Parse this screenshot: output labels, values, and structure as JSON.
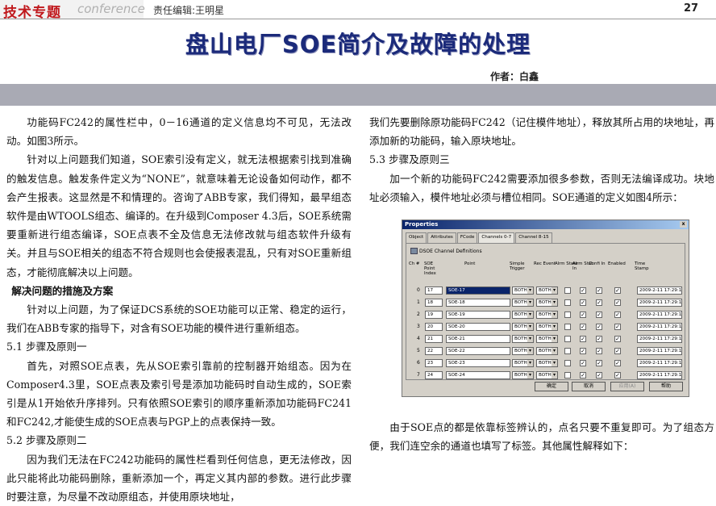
{
  "header": {
    "section_zh": "技术专题",
    "section_en": "conference",
    "editor": "责任编辑:王明星",
    "page_number": "27"
  },
  "article": {
    "title": "盘山电厂SOE简介及故障的处理",
    "author": "作者：白鑫"
  },
  "left_column": [
    {
      "type": "para",
      "text": "功能码FC242的属性栏中，0－16通道的定义信息均不可见，无法改动。如图3所示。"
    },
    {
      "type": "para",
      "text": "针对以上问题我们知道，SOE索引没有定义，就无法根据索引找到准确的触发信息。触发条件定义为“NONE”，就意味着无论设备如何动作，都不会产生报表。这显然是不和情理的。咨询了ABB专家，我们得知，最早组态软件是由WTOOLS组态、编译的。在升级到Composer 4.3后，SOE系统需要重新进行组态编译，SOE点表不全及信息无法修改就与组态软件升级有关。并且与SOE相关的组态不符合规则也会使报表混乱，只有对SOE重新组态，才能彻底解决以上问题。"
    },
    {
      "type": "heading",
      "text": "解决问题的措施及方案"
    },
    {
      "type": "para",
      "text": "针对以上问题，为了保证DCS系统的SOE功能可以正常、稳定的运行，我们在ABB专家的指导下，对含有SOE功能的模件进行重新组态。"
    },
    {
      "type": "sub",
      "text": "5.1 步骤及原则一"
    },
    {
      "type": "para",
      "text": "首先，对照SOE点表，先从SOE索引靠前的控制器开始组态。因为在Composer4.3里，SOE点表及索引号是添加功能码时自动生成的，SOE索引是从1开始依升序排列。只有依照SOE索引的顺序重新添加功能码FC241和FC242,才能使生成的SOE点表与PGP上的点表保持一致。"
    },
    {
      "type": "sub",
      "text": "5.2 步骤及原则二"
    },
    {
      "type": "para",
      "text": "因为我们无法在FC242功能码的属性栏看到任何信息，更无法修改，因此只能将此功能码删除，重新添加一个，再定义其内部的参数。进行此步骤时要注意，为尽量不改动原组态，并使用原块地址，"
    }
  ],
  "right_column_top": [
    {
      "type": "cont",
      "text": "我们先要删除原功能码FC242（记住模件地址），释放其所占用的块地址，再添加新的功能码，输入原块地址。"
    },
    {
      "type": "sub",
      "text": "5.3 步骤及原则三"
    },
    {
      "type": "para",
      "text": "加一个新的功能码FC242需要添加很多参数，否则无法编译成功。块地址必须输入，模件地址必须与槽位相同。SOE通道的定义如图4所示："
    }
  ],
  "right_column_bottom": [
    {
      "type": "para",
      "text": "由于SOE点的都是依靠标签辨认的，点名只要不重复即可。为了组态方便，我们连空余的通道也填写了标签。其他属性解释如下："
    }
  ],
  "dialog": {
    "title": "Properties",
    "close": "x",
    "tabs": [
      "Object",
      "Attributes",
      "FCode",
      "Channels 0-7",
      "Channel 8-15"
    ],
    "active_tab": "Channels 0-7",
    "group_title": "DSOE Channel Definitions",
    "columns": [
      "Ch #",
      "SOE Point Index",
      "Point",
      "Simple Trigger",
      "Rec Event",
      "Alrm State",
      "Alrm Stat In",
      "Confi In",
      "Enabled",
      "Time Stamp"
    ],
    "rows": [
      {
        "ch": "0",
        "index": "17",
        "point": "SOE-17",
        "trigger": "BOTH",
        "event": "BOTH",
        "alrm": false,
        "alrm_stat": true,
        "confi": true,
        "enabled": true,
        "ts": "2009-2-11 17:29:14",
        "selected": true
      },
      {
        "ch": "1",
        "index": "18",
        "point": "SOE-18",
        "trigger": "BOTH",
        "event": "BOTH",
        "alrm": false,
        "alrm_stat": true,
        "confi": true,
        "enabled": true,
        "ts": "2009-2-11 17:29:14",
        "selected": false
      },
      {
        "ch": "2",
        "index": "19",
        "point": "SOE-19",
        "trigger": "BOTH",
        "event": "BOTH",
        "alrm": false,
        "alrm_stat": true,
        "confi": true,
        "enabled": true,
        "ts": "2009-2-11 17:29:14",
        "selected": false
      },
      {
        "ch": "3",
        "index": "20",
        "point": "SOE-20",
        "trigger": "BOTH",
        "event": "BOTH",
        "alrm": false,
        "alrm_stat": true,
        "confi": true,
        "enabled": true,
        "ts": "2009-2-11 17:29:14",
        "selected": false
      },
      {
        "ch": "4",
        "index": "21",
        "point": "SOE-21",
        "trigger": "BOTH",
        "event": "BOTH",
        "alrm": false,
        "alrm_stat": true,
        "confi": true,
        "enabled": true,
        "ts": "2009-2-11 17:29:14",
        "selected": false
      },
      {
        "ch": "5",
        "index": "22",
        "point": "SOE-22",
        "trigger": "BOTH",
        "event": "BOTH",
        "alrm": false,
        "alrm_stat": true,
        "confi": true,
        "enabled": true,
        "ts": "2009-2-11 17:29:14",
        "selected": false
      },
      {
        "ch": "6",
        "index": "23",
        "point": "SOE-23",
        "trigger": "BOTH",
        "event": "BOTH",
        "alrm": false,
        "alrm_stat": true,
        "confi": true,
        "enabled": true,
        "ts": "2009-2-11 17:29:14",
        "selected": false
      },
      {
        "ch": "7",
        "index": "24",
        "point": "SOE-24",
        "trigger": "BOTH",
        "event": "BOTH",
        "alrm": false,
        "alrm_stat": true,
        "confi": true,
        "enabled": true,
        "ts": "2009-2-11 17:29:14",
        "selected": false
      }
    ],
    "buttons": [
      {
        "label": "确定",
        "disabled": false
      },
      {
        "label": "取消",
        "disabled": false
      },
      {
        "label": "应用(A)",
        "disabled": true
      },
      {
        "label": "帮助",
        "disabled": false
      }
    ]
  }
}
